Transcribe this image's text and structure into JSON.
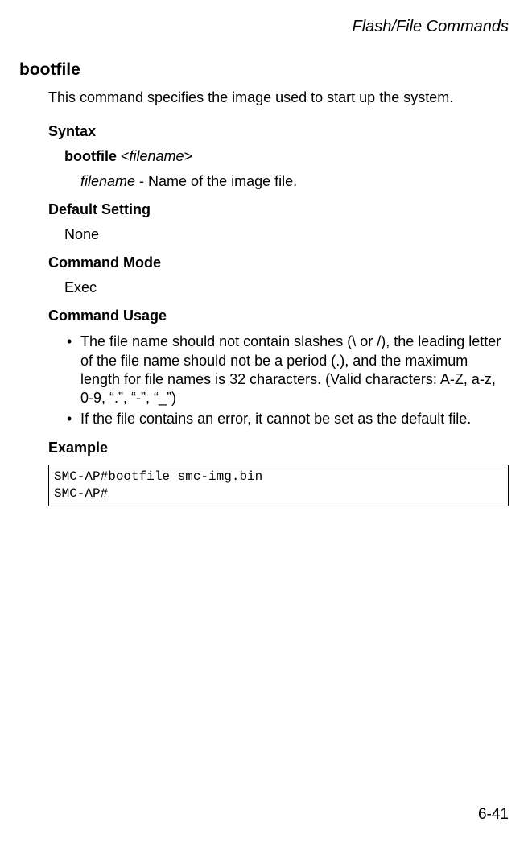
{
  "header": {
    "title": "Flash/File Commands"
  },
  "command": {
    "name": "bootfile",
    "description": "This command specifies the image used to start up the system."
  },
  "syntax": {
    "label": "Syntax",
    "command": "bootfile",
    "param_open": " <",
    "param_name": "filename",
    "param_close": ">",
    "param_desc_name": "filename",
    "param_desc_text": " - Name of the image file."
  },
  "default_setting": {
    "label": "Default Setting",
    "value": "None"
  },
  "command_mode": {
    "label": "Command Mode",
    "value": "Exec"
  },
  "command_usage": {
    "label": "Command Usage",
    "bullets": [
      "The file name should not contain slashes (\\ or /), the leading letter of the file name should not be a period (.), and the maximum length for file names is 32 characters. (Valid characters: A-Z, a-z, 0-9, “.”, “-”, “_”)",
      "If the file contains an error, it cannot be set as the default file."
    ]
  },
  "example": {
    "label": "Example",
    "content": "SMC-AP#bootfile smc-img.bin\nSMC-AP#"
  },
  "page_number": "6-41"
}
